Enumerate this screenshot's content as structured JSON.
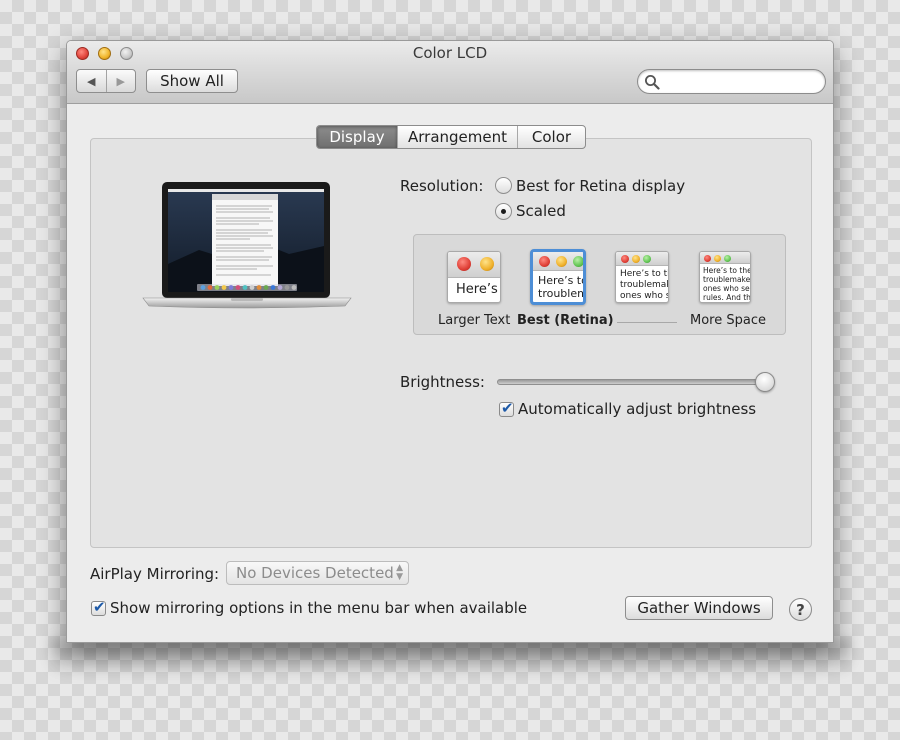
{
  "window": {
    "title": "Color LCD",
    "nav_back": "◀",
    "nav_forward": "▶",
    "show_all": "Show All",
    "search_placeholder": ""
  },
  "tabs": [
    {
      "label": "Display",
      "active": true
    },
    {
      "label": "Arrangement",
      "active": false
    },
    {
      "label": "Color",
      "active": false
    }
  ],
  "display": {
    "resolution_label": "Resolution:",
    "options": [
      {
        "label": "Best for Retina display",
        "selected": false
      },
      {
        "label": "Scaled",
        "selected": true
      }
    ],
    "scaled_choices": [
      {
        "label": "Larger Text",
        "preview": "Here’s",
        "selected": false
      },
      {
        "label": "Best (Retina)",
        "preview": "Here’s to\ntroublem",
        "selected": true
      },
      {
        "label": "",
        "preview": "Here’s to th\ntroublemak\nones who s",
        "selected": false
      },
      {
        "label": "More Space",
        "preview": "Here’s to the c\ntroublemakers.\nones who see t\nrules. And they",
        "selected": false
      }
    ],
    "brightness_label": "Brightness:",
    "brightness_value": 1.0,
    "auto_brightness": {
      "label": "Automatically adjust brightness",
      "checked": true
    }
  },
  "footer": {
    "airplay_label": "AirPlay Mirroring:",
    "airplay_value": "No Devices Detected",
    "show_mirroring": {
      "label": "Show mirroring options in the menu bar when available",
      "checked": true
    },
    "gather_windows": "Gather Windows",
    "help": "?"
  },
  "colors": {
    "accent": "#4d8ed6",
    "tab_active": "#7a7a7a",
    "window_bg": "#ececec"
  }
}
